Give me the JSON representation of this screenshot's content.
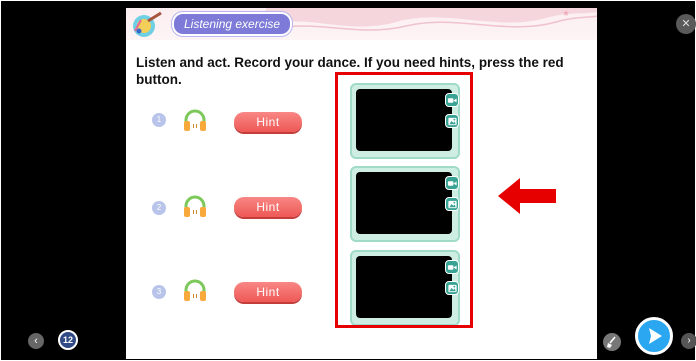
{
  "header": {
    "tag_label": "Listening exercise"
  },
  "instruction": "Listen and act.  Record your dance.  If you need hints, press the red button.",
  "exercises": [
    {
      "number": "1",
      "hint_label": "Hint"
    },
    {
      "number": "2",
      "hint_label": "Hint"
    },
    {
      "number": "3",
      "hint_label": "Hint"
    }
  ],
  "footer": {
    "page_number": "12"
  },
  "icons": {
    "headphones": "headphones-icon",
    "video_camera": "video-camera-icon",
    "photo": "photo-icon",
    "annotation_arrow": "left-arrow-icon",
    "send": "play-send-icon",
    "brush": "brush-icon",
    "close": "close-icon",
    "prev": "chevron-left-icon",
    "next": "chevron-right-icon"
  },
  "colors": {
    "hint_button": "#ee5855",
    "tag_purple": "#7d7ad8",
    "record_teal": "#39a394",
    "highlight_red": "#e60000",
    "send_blue": "#2aa7f0"
  }
}
